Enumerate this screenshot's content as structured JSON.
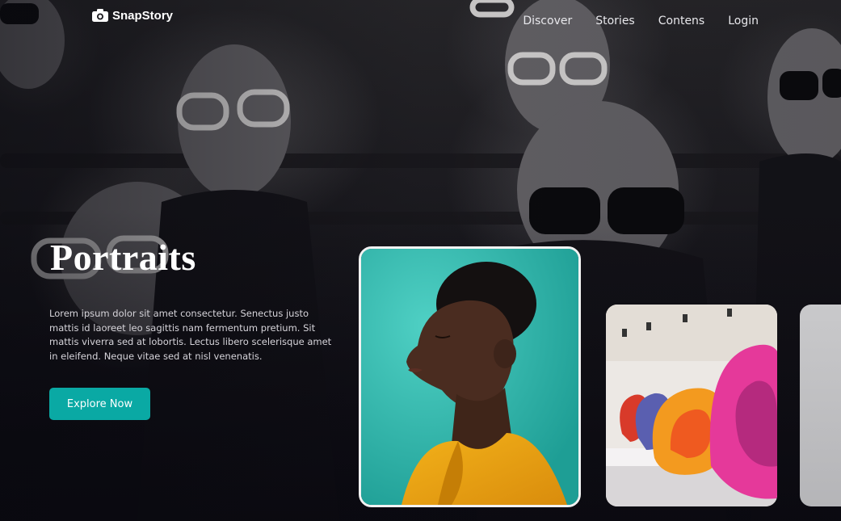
{
  "app": {
    "name": "SnapStory"
  },
  "nav": {
    "items": [
      {
        "label": "Discover"
      },
      {
        "label": "Stories"
      },
      {
        "label": "Contens"
      },
      {
        "label": "Login"
      }
    ]
  },
  "hero": {
    "title": "Portraits",
    "description": "Lorem ipsum dolor sit amet consectetur. Senectus justo mattis id laoreet leo sagittis nam fermentum pretium. Sit mattis viverra sed at lobortis. Lectus libero scelerisque amet in eleifend. Neque vitae sed at nisl venenatis.",
    "cta_label": "Explore Now"
  },
  "gallery": {
    "cards": [
      {
        "subject": "portrait-photo"
      },
      {
        "subject": "gallery-sculpture-photo"
      },
      {
        "subject": "partial-photo"
      }
    ]
  },
  "colors": {
    "accent": "#0aa9a4",
    "background": "#0d0c14",
    "text": "#ffffff"
  }
}
